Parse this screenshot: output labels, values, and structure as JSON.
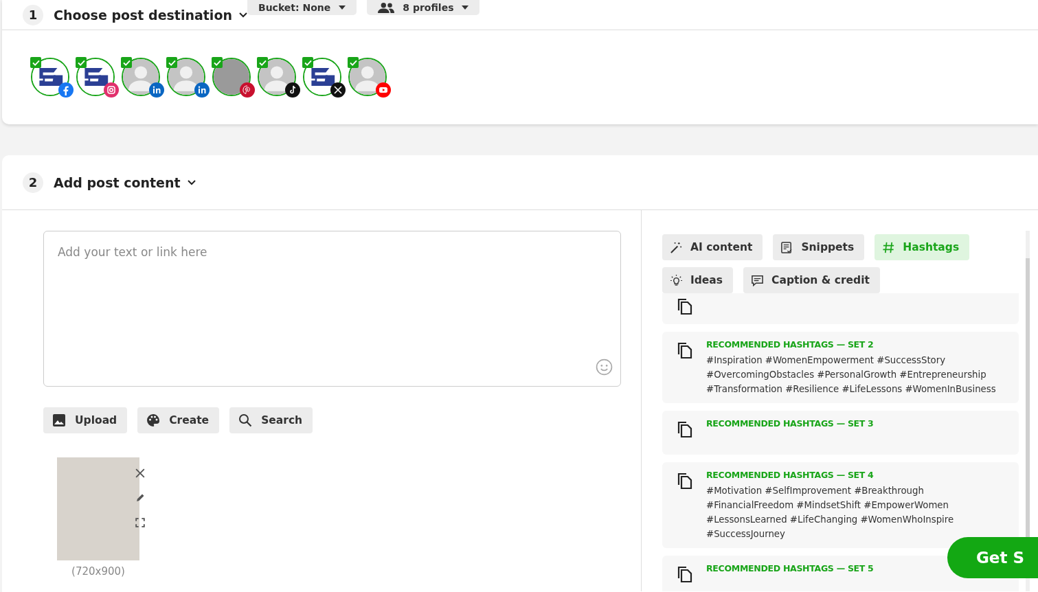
{
  "step1": {
    "number": "1",
    "title": "Choose post destination",
    "bucket": "Bucket: None",
    "profiles_button": "8 profiles",
    "profiles": [
      {
        "avatar": {
          "kind": "logo"
        },
        "badge": {
          "kind": "facebook",
          "color": "#1877f2"
        },
        "checked": true
      },
      {
        "avatar": {
          "kind": "logo"
        },
        "badge": {
          "kind": "instagram",
          "color": "#e1306c"
        },
        "checked": true
      },
      {
        "avatar": {
          "kind": "person"
        },
        "badge": {
          "kind": "linkedin",
          "color": "#0a66c2"
        },
        "checked": true
      },
      {
        "avatar": {
          "kind": "person"
        },
        "badge": {
          "kind": "linkedin",
          "color": "#0a66c2"
        },
        "checked": true
      },
      {
        "avatar": {
          "kind": "photo"
        },
        "badge": {
          "kind": "pinterest",
          "color": "#c8102e"
        },
        "checked": true
      },
      {
        "avatar": {
          "kind": "person"
        },
        "badge": {
          "kind": "tiktok",
          "color": "#111111"
        },
        "checked": true
      },
      {
        "avatar": {
          "kind": "logo"
        },
        "badge": {
          "kind": "x",
          "color": "#111111"
        },
        "checked": true
      },
      {
        "avatar": {
          "kind": "person"
        },
        "badge": {
          "kind": "youtube",
          "color": "#ff0000"
        },
        "checked": true
      }
    ]
  },
  "step2": {
    "number": "2",
    "title": "Add post content",
    "editor": {
      "placeholder": "Add your text or link here"
    },
    "media_buttons": [
      {
        "kind": "upload",
        "label": "Upload"
      },
      {
        "kind": "create",
        "label": "Create"
      },
      {
        "kind": "search",
        "label": "Search"
      }
    ],
    "attachment": {
      "size": "(720x900)"
    },
    "tabs": [
      {
        "kind": "ai",
        "label": "AI content",
        "selected": false
      },
      {
        "kind": "snippets",
        "label": "Snippets",
        "selected": false
      },
      {
        "kind": "hashtags",
        "label": "Hashtags",
        "selected": true
      },
      {
        "kind": "ideas",
        "label": "Ideas",
        "selected": false
      },
      {
        "kind": "caption",
        "label": "Caption & credit",
        "selected": false
      }
    ],
    "hashtag_sets": [
      {
        "title": "RECOMMENDED HASHTAGS — SET 2",
        "text": "#Inspiration #WomenEmpowerment #SuccessStory #OvercomingObstacles #PersonalGrowth #Entrepreneurship #Transformation #Resilience #LifeLessons #WomenInBusiness"
      },
      {
        "title": "RECOMMENDED HASHTAGS — SET 3"
      },
      {
        "title": "RECOMMENDED HASHTAGS — SET 4",
        "text": "#Motivation #SelfImprovement #Breakthrough #FinancialFreedom #MindsetShift #EmpowerWomen #LessonsLearned #LifeChanging #WomenWhoInspire #SuccessJourney"
      },
      {
        "title": "RECOMMENDED HASHTAGS — SET 5"
      }
    ]
  },
  "cta": {
    "label": "Get S"
  }
}
